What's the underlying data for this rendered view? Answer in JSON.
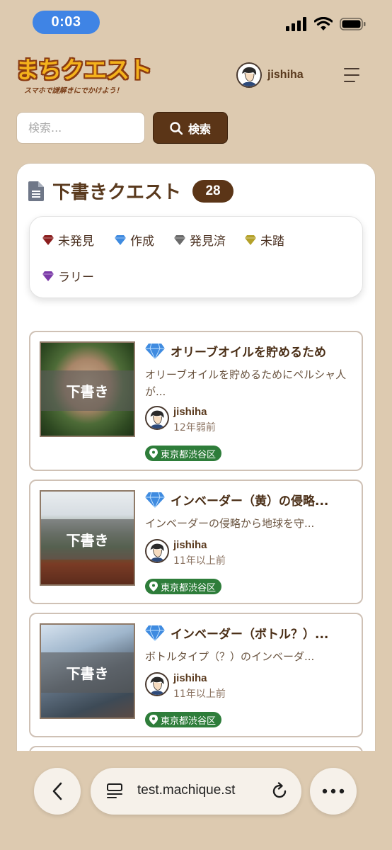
{
  "status_bar": {
    "time": "0:03"
  },
  "header": {
    "logo_text": "まちクエスト",
    "logo_tagline": "スマホで謎解きにでかけよう！",
    "username": "jishiha"
  },
  "search": {
    "placeholder": "検索...",
    "button_label": "検索"
  },
  "panel": {
    "title": "下書きクエスト",
    "count": "28",
    "legend": [
      {
        "label": "未発見",
        "color": "#8b1e1e"
      },
      {
        "label": "作成",
        "color": "#3f8be0"
      },
      {
        "label": "発見済",
        "color": "#6b6b6b"
      },
      {
        "label": "未踏",
        "color": "#b4a12a"
      },
      {
        "label": "ラリー",
        "color": "#7b3aa8"
      }
    ]
  },
  "quests": [
    {
      "title": "オリーブオイルを貯めるため",
      "description": "オリーブオイルを貯めるためにペルシャ人が...",
      "author": "jishiha",
      "time": "12年弱前",
      "location": "東京都渋谷区",
      "badge": "下書き"
    },
    {
      "title": "インベーダー（黄）の侵略...",
      "description": "インベーダーの侵略から地球を守...",
      "author": "jishiha",
      "time": "11年以上前",
      "location": "東京都渋谷区",
      "badge": "下書き"
    },
    {
      "title": "インベーダー（ボトル？）...",
      "description": "ボトルタイプ（？）のインベーダ...",
      "author": "jishiha",
      "time": "11年以上前",
      "location": "東京都渋谷区",
      "badge": "下書き"
    }
  ],
  "browser": {
    "url": "test.machique.st"
  }
}
